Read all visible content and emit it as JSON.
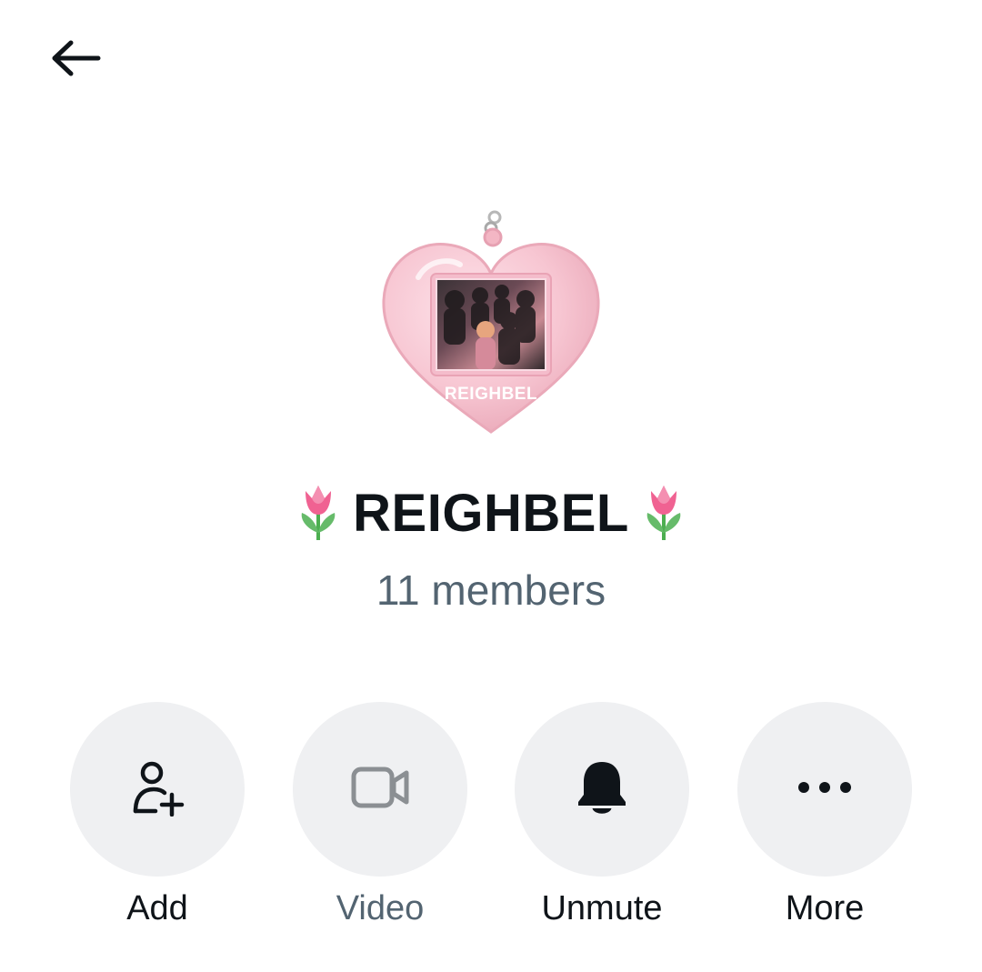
{
  "header": {
    "back_icon": "arrow-left-icon"
  },
  "group": {
    "avatar_text": "REIGHBEL",
    "name": "REIGHBEL",
    "emoji_left": "tulip-emoji",
    "emoji_right": "tulip-emoji",
    "members": "11 members"
  },
  "actions": [
    {
      "label": "Add",
      "icon": "add-person-icon",
      "enabled": true
    },
    {
      "label": "Video",
      "icon": "video-camera-icon",
      "enabled": false
    },
    {
      "label": "Unmute",
      "icon": "bell-icon",
      "enabled": true
    },
    {
      "label": "More",
      "icon": "more-dots-icon",
      "enabled": true
    }
  ],
  "colors": {
    "text_primary": "#0f1419",
    "text_secondary": "#536471",
    "button_bg": "#eff0f2",
    "avatar_pink": "#f7c6d2"
  }
}
